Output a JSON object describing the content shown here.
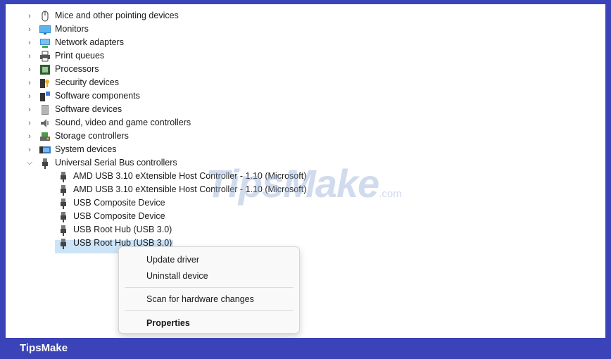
{
  "tree": {
    "categories": [
      {
        "label": "Mice and other pointing devices",
        "icon": "mouse-icon"
      },
      {
        "label": "Monitors",
        "icon": "monitor-icon"
      },
      {
        "label": "Network adapters",
        "icon": "network-adapter-icon"
      },
      {
        "label": "Print queues",
        "icon": "printer-icon"
      },
      {
        "label": "Processors",
        "icon": "processor-icon"
      },
      {
        "label": "Security devices",
        "icon": "security-device-icon"
      },
      {
        "label": "Software components",
        "icon": "software-component-icon"
      },
      {
        "label": "Software devices",
        "icon": "software-device-icon"
      },
      {
        "label": "Sound, video and game controllers",
        "icon": "speaker-icon"
      },
      {
        "label": "Storage controllers",
        "icon": "storage-controller-icon"
      },
      {
        "label": "System devices",
        "icon": "system-devices-icon"
      }
    ],
    "expanded_category": {
      "label": "Universal Serial Bus controllers",
      "icon": "usb-icon"
    },
    "children": [
      {
        "label": "AMD USB 3.10 eXtensible Host Controller - 1.10 (Microsoft)",
        "icon": "usb-icon"
      },
      {
        "label": "AMD USB 3.10 eXtensible Host Controller - 1.10 (Microsoft)",
        "icon": "usb-icon"
      },
      {
        "label": "USB Composite Device",
        "icon": "usb-icon"
      },
      {
        "label": "USB Composite Device",
        "icon": "usb-icon"
      },
      {
        "label": "USB Root Hub (USB 3.0)",
        "icon": "usb-icon"
      },
      {
        "label": "USB Root Hub (USB 3.0)",
        "icon": "usb-icon",
        "selected": true
      }
    ]
  },
  "context_menu": {
    "update_driver": "Update driver",
    "uninstall_device": "Uninstall device",
    "scan_hardware": "Scan for hardware changes",
    "properties": "Properties"
  },
  "watermark": {
    "text": "TipsMake",
    "suffix": ".com"
  },
  "footer": {
    "brand": "TipsMake"
  },
  "colors": {
    "accent": "#3a44b8",
    "selection": "#cce4f7",
    "menu_bg": "#f9f9f9"
  }
}
